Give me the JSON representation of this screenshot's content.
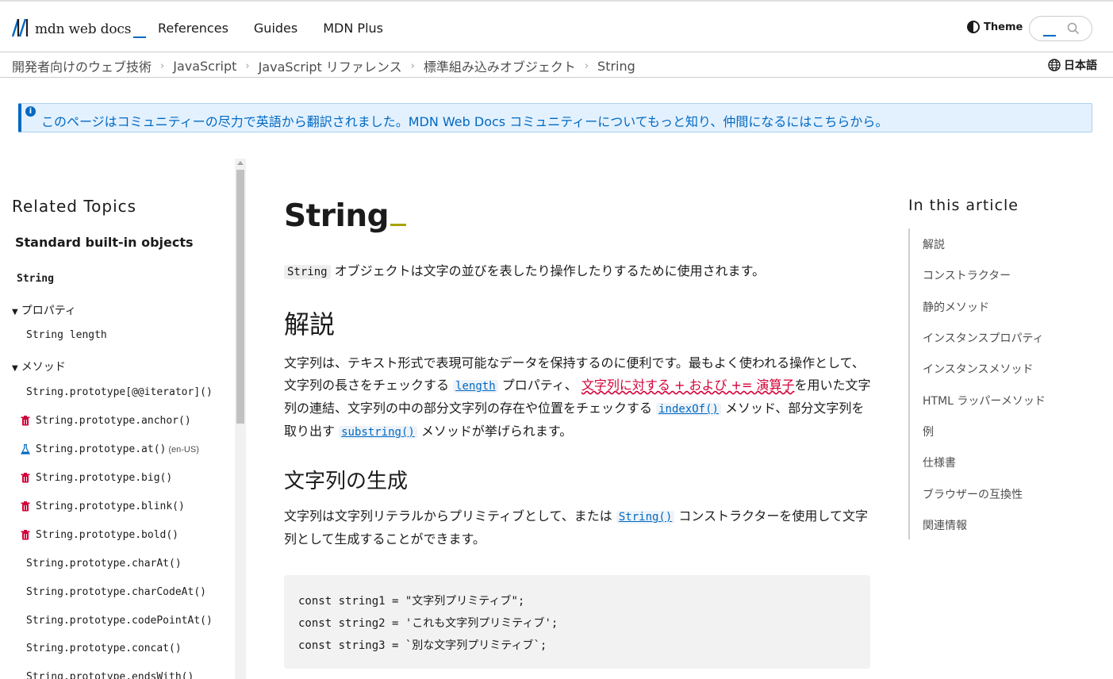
{
  "header": {
    "logo_text": "mdn web docs",
    "nav": [
      "References",
      "Guides",
      "MDN Plus"
    ],
    "theme_label": "Theme"
  },
  "breadcrumb": {
    "items": [
      "開発者向けのウェブ技術",
      "JavaScript",
      "JavaScript リファレンス",
      "標準組み込みオブジェクト",
      "String"
    ],
    "language": "日本語"
  },
  "notice": {
    "icon": "info-icon",
    "text": "このページはコミュニティーの尽力で英語から翻訳されました。MDN Web Docs コミュニティーについてもっと知り、仲間になるにはこちらから。"
  },
  "sidebar": {
    "title": "Related Topics",
    "group": "Standard built-in objects",
    "current": "String",
    "section_properties": "プロパティ",
    "properties": [
      "String length"
    ],
    "section_methods": "メソッド",
    "methods": [
      {
        "label": "String.prototype[@@iterator]()",
        "icon": "",
        "tag": ""
      },
      {
        "label": "String.prototype.anchor()",
        "icon": "trash-icon",
        "tag": ""
      },
      {
        "label": "String.prototype.at()",
        "icon": "flask-icon",
        "tag": "(en-US)"
      },
      {
        "label": "String.prototype.big()",
        "icon": "trash-icon",
        "tag": ""
      },
      {
        "label": "String.prototype.blink()",
        "icon": "trash-icon",
        "tag": ""
      },
      {
        "label": "String.prototype.bold()",
        "icon": "trash-icon",
        "tag": ""
      },
      {
        "label": "String.prototype.charAt()",
        "icon": "",
        "tag": ""
      },
      {
        "label": "String.prototype.charCodeAt()",
        "icon": "",
        "tag": ""
      },
      {
        "label": "String.prototype.codePointAt()",
        "icon": "",
        "tag": ""
      },
      {
        "label": "String.prototype.concat()",
        "icon": "",
        "tag": ""
      },
      {
        "label": "String.prototype.endsWith()",
        "icon": "",
        "tag": ""
      }
    ]
  },
  "article": {
    "title": "String",
    "intro_code": "String",
    "intro_text": " オブジェクトは文字の並びを表したり操作したりするために使用されます。",
    "h2_description": "解説",
    "desc_p1": "文字列は、テキスト形式で表現可能なデータを保持するのに便利です。最もよく使われる操作として、文字列の長さをチェックする ",
    "desc_link_length": "length",
    "desc_p2": " プロパティ、 ",
    "desc_link_operators": "文字列に対する + および += 演算子",
    "desc_p3": "を用いた文字列の連結、文字列の中の部分文字列の存在や位置をチェックする ",
    "desc_link_indexof": "indexOf()",
    "desc_p4": " メソッド、部分文字列を取り出す ",
    "desc_link_substring": "substring()",
    "desc_p5": " メソッドが挙げられます。",
    "h3_creating": "文字列の生成",
    "create_p1": "文字列は文字列リテラルからプリミティブとして、または ",
    "create_link_string": "String()",
    "create_p2": " コンストラクターを使用して文字列として生成することができます。",
    "code_lines": [
      "const string1 = \"文字列プリミティブ\";",
      "const string2 = 'これも文字列プリミティブ';",
      "const string3 = `別な文字列プリミティブ`;"
    ]
  },
  "toc": {
    "title": "In this article",
    "items": [
      "解説",
      "コンストラクター",
      "静的メソッド",
      "インスタンスプロパティ",
      "インスタンスメソッド",
      "HTML ラッパーメソッド",
      "例",
      "仕様書",
      "ブラウザーの互換性",
      "関連情報"
    ]
  },
  "colors": {
    "accent": "#0069c2",
    "deprecated": "#d30038",
    "notice_bg": "#e3f1ff"
  }
}
